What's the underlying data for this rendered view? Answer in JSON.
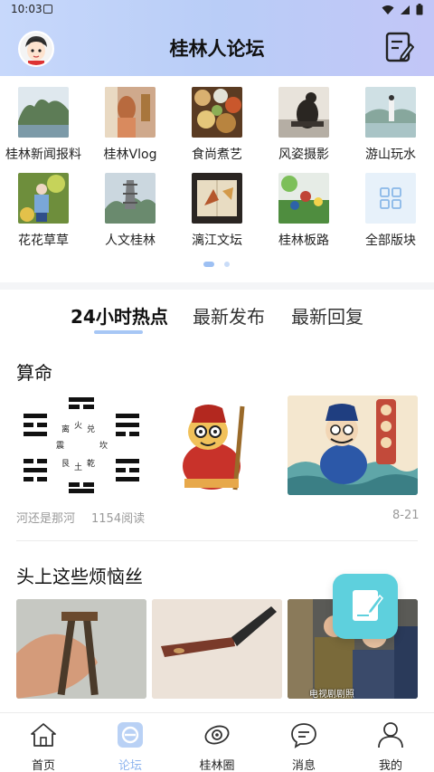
{
  "status_bar": {
    "time": "10:03"
  },
  "header": {
    "title": "桂林人论坛"
  },
  "forums": [
    {
      "label": "桂林新闻报料"
    },
    {
      "label": "桂林Vlog"
    },
    {
      "label": "食尚煮艺"
    },
    {
      "label": "风姿摄影"
    },
    {
      "label": "游山玩水"
    },
    {
      "label": "花花草草"
    },
    {
      "label": "人文桂林"
    },
    {
      "label": "漓江文坛"
    },
    {
      "label": "桂林板路"
    },
    {
      "label": "全部版块"
    }
  ],
  "tabs": [
    {
      "label": "24小时热点",
      "active": true
    },
    {
      "label": "最新发布",
      "active": false
    },
    {
      "label": "最新回复",
      "active": false
    }
  ],
  "posts": [
    {
      "title": "算命",
      "author": "河还是那河",
      "reads": "1154阅读",
      "date": "8-21"
    },
    {
      "title": "头上这些烦恼丝",
      "image_caption": "电视剧剧照"
    }
  ],
  "bottom_nav": [
    {
      "label": "首页",
      "icon": "home-icon"
    },
    {
      "label": "论坛",
      "icon": "forum-icon",
      "active": true
    },
    {
      "label": "桂林圈",
      "icon": "circle-icon"
    },
    {
      "label": "消息",
      "icon": "message-icon"
    },
    {
      "label": "我的",
      "icon": "profile-icon"
    }
  ],
  "colors": {
    "accent": "#a7c7f5",
    "fab": "#5ed0dd",
    "header_gradient": [
      "#c7d8fb",
      "#c2c6f7"
    ]
  }
}
